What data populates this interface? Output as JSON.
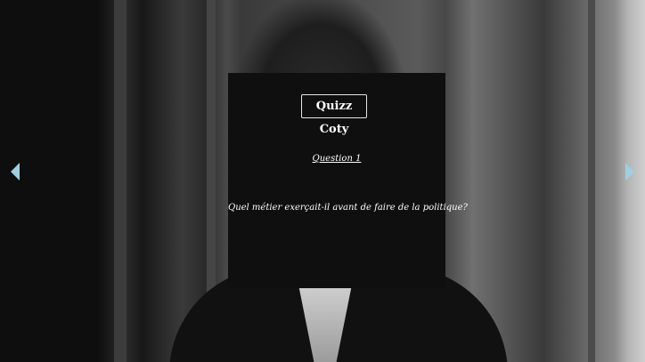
{
  "quiz": {
    "title": "Quizz Coty",
    "question_number": "Question 1",
    "question_text": "Quel métier exerçait-il avant de faire de la politique?"
  },
  "nav": {
    "prev_icon": "chevron-left-icon",
    "next_icon": "chevron-right-icon",
    "arrow_color": "#9fcfe0"
  },
  "colors": {
    "card_background": "#0f0f10",
    "text": "#ffffff"
  }
}
